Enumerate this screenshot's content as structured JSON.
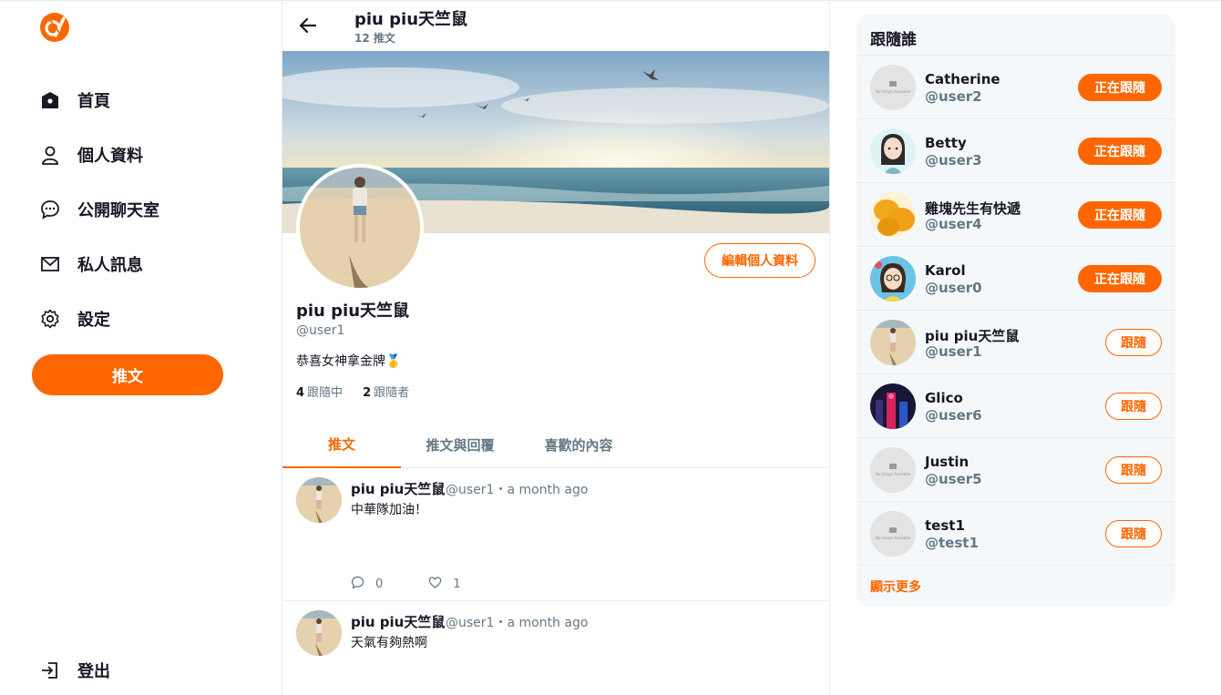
{
  "colors": {
    "accent": "#ff6600",
    "muted": "#657786",
    "panel_bg": "#f5f8fa"
  },
  "sidebar": {
    "logo": "alphacamp-logo",
    "items": [
      {
        "label": "首頁",
        "icon": "home-icon"
      },
      {
        "label": "個人資料",
        "icon": "user-icon"
      },
      {
        "label": "公開聊天室",
        "icon": "chat-icon"
      },
      {
        "label": "私人訊息",
        "icon": "mail-icon"
      },
      {
        "label": "設定",
        "icon": "gear-icon"
      }
    ],
    "tweet_button": "推文",
    "logout": "登出"
  },
  "header": {
    "name": "piu piu天竺鼠",
    "tweet_count": "12 推文"
  },
  "profile": {
    "name": "piu piu天竺鼠",
    "handle": "@user1",
    "bio": "恭喜女神拿金牌🥇",
    "edit_button": "編輯個人資料",
    "following_count": "4",
    "following_label": "跟隨中",
    "followers_count": "2",
    "followers_label": "跟隨者"
  },
  "tabs": [
    {
      "label": "推文",
      "active": true
    },
    {
      "label": "推文與回覆",
      "active": false
    },
    {
      "label": "喜歡的內容",
      "active": false
    }
  ],
  "tweets": [
    {
      "name": "piu piu天竺鼠",
      "handle": "@user1",
      "time": "a month ago",
      "meta": "@user1・a month ago",
      "text": "中華隊加油！",
      "replies": "0",
      "likes": "1"
    },
    {
      "name": "piu piu天竺鼠",
      "handle": "@user1",
      "time": "a month ago",
      "meta": "@user1・a month ago",
      "text": "天氣有夠熱啊"
    }
  ],
  "who_to_follow": {
    "title": "跟隨誰",
    "show_more": "顯示更多",
    "users": [
      {
        "name": "Catherine",
        "handle": "@user2",
        "button": "正在跟隨",
        "following": true,
        "avatar": "no-image"
      },
      {
        "name": "Betty",
        "handle": "@user3",
        "button": "正在跟隨",
        "following": true,
        "avatar": "cartoon-girl-1"
      },
      {
        "name": "雞塊先生有快遞",
        "handle": "@user4",
        "button": "正在跟隨",
        "following": true,
        "avatar": "nuggets"
      },
      {
        "name": "Karol",
        "handle": "@user0",
        "button": "正在跟隨",
        "following": true,
        "avatar": "cartoon-girl-2"
      },
      {
        "name": "piu piu天竺鼠",
        "handle": "@user1",
        "button": "跟隨",
        "following": false,
        "avatar": "beach-photo"
      },
      {
        "name": "Glico",
        "handle": "@user6",
        "button": "跟隨",
        "following": false,
        "avatar": "night-city"
      },
      {
        "name": "Justin",
        "handle": "@user5",
        "button": "跟隨",
        "following": false,
        "avatar": "no-image"
      },
      {
        "name": "test1",
        "handle": "@test1",
        "button": "跟隨",
        "following": false,
        "avatar": "no-image"
      }
    ],
    "no_image_text": "No Image Available"
  }
}
